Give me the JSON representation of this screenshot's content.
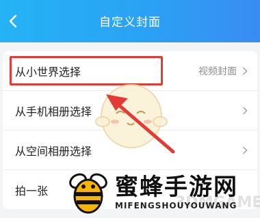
{
  "header": {
    "title": "自定义封面"
  },
  "list": {
    "items": [
      {
        "label": "从小世界选择",
        "value": "视频封面"
      },
      {
        "label": "从手机相册选择",
        "value": ""
      },
      {
        "label": "从空间相册选择",
        "value": ""
      },
      {
        "label": "拍一张",
        "value": ""
      }
    ]
  },
  "watermark": {
    "title": "蜜蜂手游网",
    "subtitle": "MIFENGSHOUYOUWANG",
    "faded": "3DMGAME"
  },
  "colors": {
    "header_start": "#25b3f5",
    "header_end": "#3a8cf2",
    "highlight": "#e53935"
  }
}
